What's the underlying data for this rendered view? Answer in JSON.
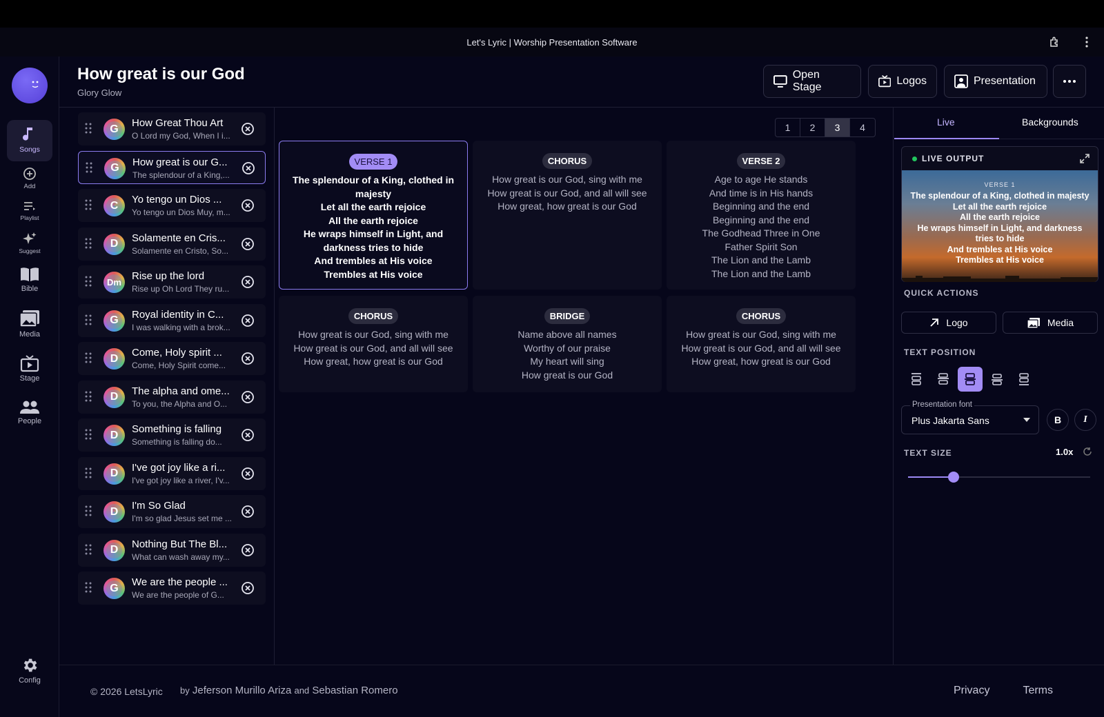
{
  "window": {
    "title": "Let's Lyric | Worship Presentation Software"
  },
  "rail": {
    "items": [
      {
        "label": "Songs",
        "icon": "music-note-icon"
      },
      {
        "label": "Add",
        "icon": "plus-circle-icon"
      },
      {
        "label": "Playlist",
        "icon": "playlist-icon"
      },
      {
        "label": "Suggest",
        "icon": "sparkle-icon"
      },
      {
        "label": "Bible",
        "icon": "book-icon"
      },
      {
        "label": "Media",
        "icon": "image-icon"
      },
      {
        "label": "Stage",
        "icon": "tv-icon"
      },
      {
        "label": "People",
        "icon": "people-icon"
      },
      {
        "label": "Config",
        "icon": "gear-icon"
      }
    ]
  },
  "header": {
    "title": "How great is our God",
    "artist": "Glory Glow",
    "buttons": {
      "open_stage": "Open Stage",
      "logos": "Logos",
      "presentation": "Presentation"
    }
  },
  "songs": [
    {
      "initial": "G",
      "title": "How Great Thou Art",
      "line": "O Lord my God, When I i..."
    },
    {
      "initial": "G",
      "title": "How great is our G...",
      "line": "The splendour of a King,..."
    },
    {
      "initial": "C",
      "title": "Yo tengo un Dios ...",
      "line": "Yo tengo un Dios Muy, m..."
    },
    {
      "initial": "D",
      "title": "Solamente en Cris...",
      "line": "Solamente en Cristo, So..."
    },
    {
      "initial": "Dm",
      "title": "Rise up the lord",
      "line": "Rise up Oh Lord They ru..."
    },
    {
      "initial": "G",
      "title": "Royal identity in C...",
      "line": "I was walking with a brok..."
    },
    {
      "initial": "D",
      "title": "Come, Holy spirit ...",
      "line": "Come, Holy Spirit come..."
    },
    {
      "initial": "D",
      "title": "The alpha and ome...",
      "line": "To you, the Alpha and O..."
    },
    {
      "initial": "D",
      "title": "Something is falling",
      "line": "Something is falling do..."
    },
    {
      "initial": "D",
      "title": "I've got joy like a ri...",
      "line": "I've got joy like a river, I'v..."
    },
    {
      "initial": "D",
      "title": "I'm So Glad",
      "line": "I'm so glad Jesus set me ..."
    },
    {
      "initial": "D",
      "title": "Nothing But The Bl...",
      "line": "What can wash away my..."
    },
    {
      "initial": "G",
      "title": "We are the people ...",
      "line": "We are the people of G..."
    }
  ],
  "pager": {
    "pages": [
      "1",
      "2",
      "3",
      "4"
    ],
    "current": "3"
  },
  "slides": [
    {
      "tag": "VERSE 1",
      "lines": "The splendour of a King, clothed in majesty\nLet all the earth rejoice\nAll the earth rejoice\nHe wraps himself in Light, and darkness tries to hide\nAnd trembles at His voice\nTrembles at His voice"
    },
    {
      "tag": "CHORUS",
      "lines": "How great is our God, sing with me\nHow great is our God, and all will see\nHow great, how great is our God"
    },
    {
      "tag": "VERSE 2",
      "lines": "Age to age He stands\nAnd time is in His hands\nBeginning and the end\nBeginning and the end\nThe Godhead Three in One\nFather Spirit Son\nThe Lion and the Lamb\nThe Lion and the Lamb"
    },
    {
      "tag": "CHORUS",
      "lines": "How great is our God, sing with me\nHow great is our God, and all will see\nHow great, how great is our God"
    },
    {
      "tag": "BRIDGE",
      "lines": "Name above all names\nWorthy of our praise\nMy heart will sing\nHow great is our God"
    },
    {
      "tag": "CHORUS",
      "lines": "How great is our God, sing with me\nHow great is our God, and all will see\nHow great, how great is our God"
    }
  ],
  "side": {
    "tabs": {
      "live": "Live",
      "backgrounds": "Backgrounds"
    },
    "live_output": "LIVE OUTPUT",
    "preview_tag": "VERSE 1",
    "preview_lines": "The splendour of a King, clothed in majesty\nLet all the earth rejoice\nAll the earth rejoice\nHe wraps himself in Light, and darkness tries to hide\nAnd trembles at His voice\nTrembles at His voice",
    "quick_actions": "QUICK ACTIONS",
    "logo_btn": "Logo",
    "media_btn": "Media",
    "text_position": "TEXT POSITION",
    "font_label": "Presentation font",
    "font_value": "Plus Jakarta Sans",
    "bold": "B",
    "italic": "I",
    "text_size": "TEXT SIZE",
    "text_size_value": "1.0x",
    "text_size_fraction": 0.25
  },
  "footer": {
    "copyright": "© 2026 LetsLyric",
    "by": "by",
    "author1": "Jeferson Murillo Ariza",
    "and": "and",
    "author2": "Sebastian Romero",
    "privacy": "Privacy",
    "terms": "Terms"
  },
  "colors": {
    "accent": "#a28cf5",
    "live_dot": "#22c55e"
  }
}
